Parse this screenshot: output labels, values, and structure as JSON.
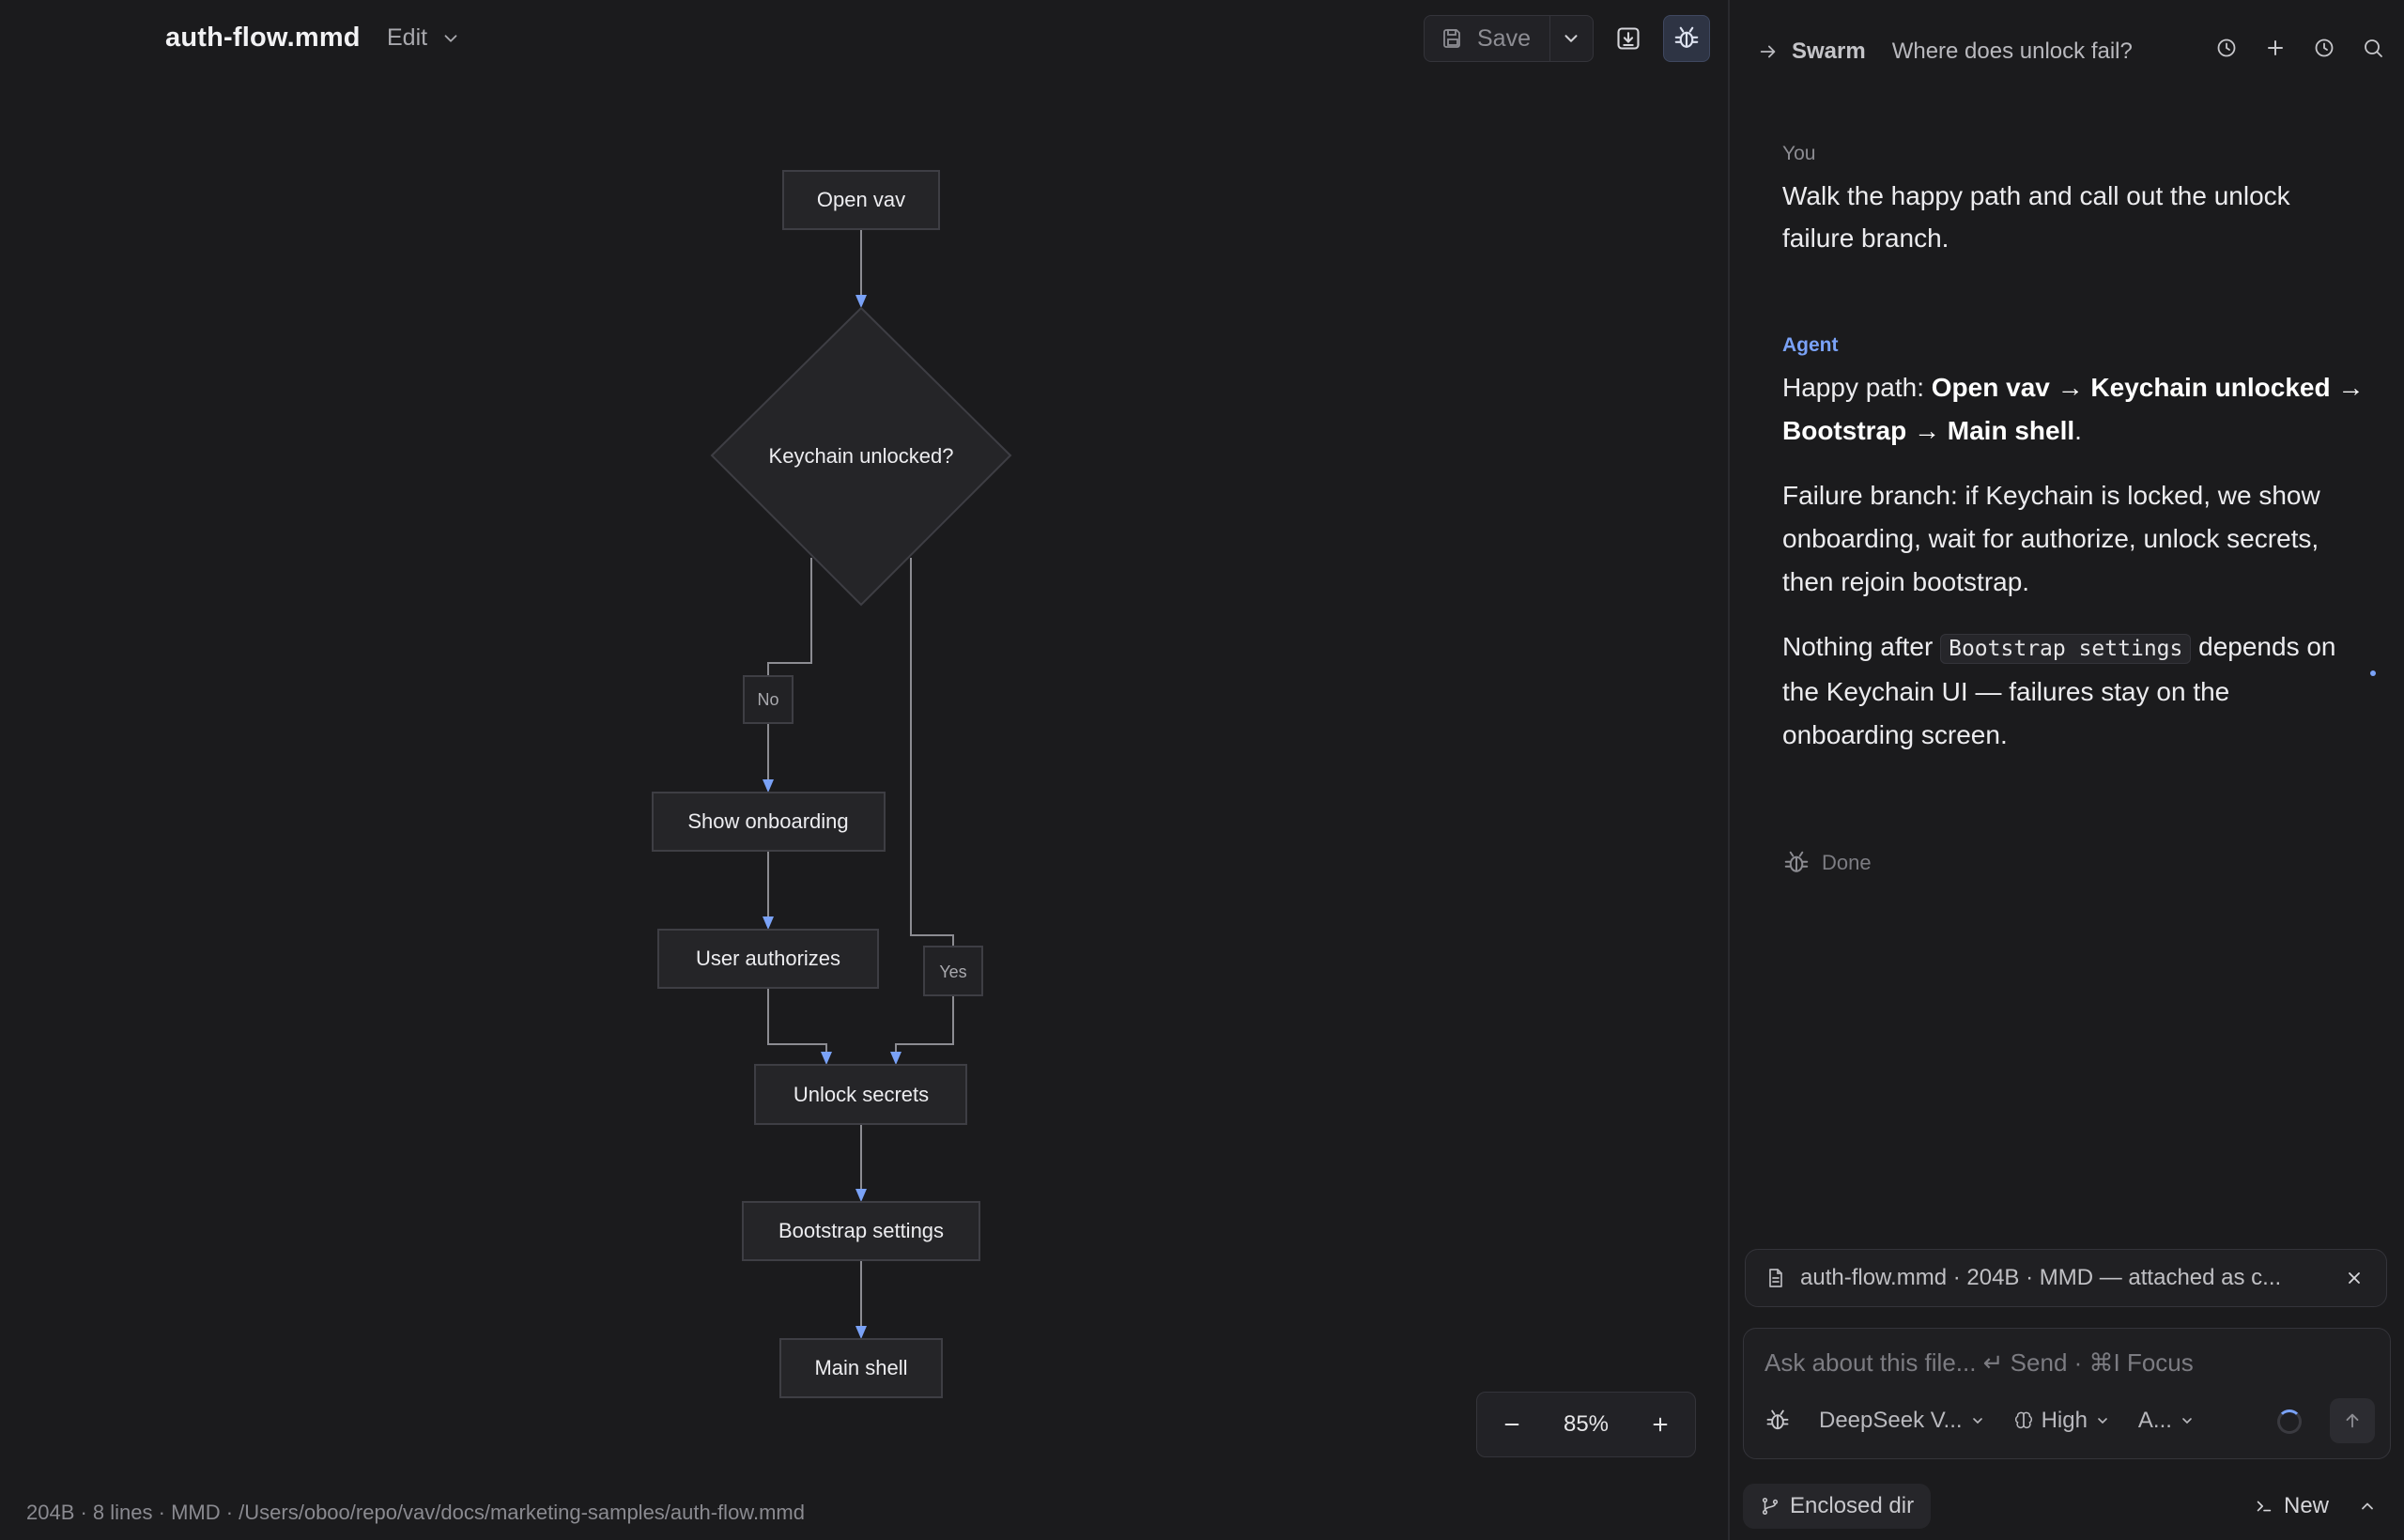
{
  "editor": {
    "file_title": "auth-flow.mmd",
    "edit_label": "Edit",
    "save_label": "Save",
    "zoom_level": "85%",
    "status_bar": "204B · 8 lines · MMD · /Users/oboo/repo/vav/docs/marketing-samples/auth-flow.mmd"
  },
  "diagram": {
    "nodes": {
      "open_vav": "Open vav",
      "keychain": "Keychain unlocked?",
      "show_onboarding": "Show onboarding",
      "user_authorizes": "User authorizes",
      "unlock_secrets": "Unlock secrets",
      "bootstrap_settings": "Bootstrap settings",
      "main_shell": "Main shell"
    },
    "edge_labels": {
      "no": "No",
      "yes": "Yes"
    }
  },
  "chat": {
    "swarm_label": "Swarm",
    "title": "Where does unlock fail?",
    "you_role": "You",
    "you_message": "Walk the happy path and call out the unlock failure branch.",
    "agent_role": "Agent",
    "agent": {
      "p1_prefix": "Happy path: ",
      "p1_bold": "Open vav → Keychain unlocked → Bootstrap → Main shell",
      "p1_suffix": ".",
      "p2": "Failure branch: if Keychain is locked, we show onboarding, wait for authorize, unlock secrets, then rejoin bootstrap.",
      "p3_prefix": "Nothing after ",
      "p3_code": "Bootstrap settings",
      "p3_suffix": " depends on the Keychain UI — failures stay on the onboarding screen."
    },
    "done_label": "Done",
    "attachment": "auth-flow.mmd · 204B · MMD — attached as c...",
    "input_placeholder": "Ask about this file... ↵ Send · ⌘I Focus",
    "model_label": "DeepSeek V...",
    "effort_label": "High",
    "mode_label": "A...",
    "enclosed_label": "Enclosed dir",
    "new_label": "New"
  },
  "colors": {
    "background": "#1b1b1d",
    "accent": "#7aa2f7",
    "node_fill": "#252528",
    "node_stroke": "#3e3e44"
  }
}
